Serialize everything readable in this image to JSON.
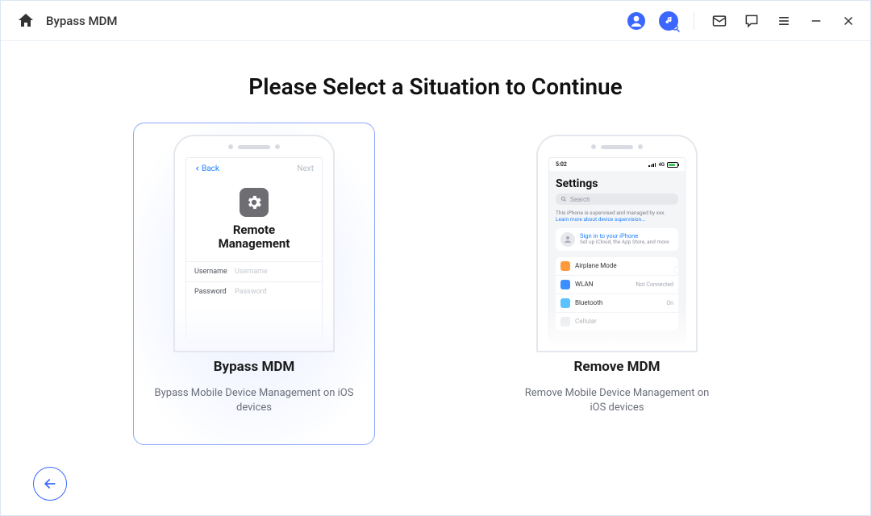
{
  "header": {
    "title": "Bypass MDM"
  },
  "main": {
    "heading": "Please Select a Situation to Continue"
  },
  "options": {
    "bypass": {
      "title": "Bypass MDM",
      "description": "Bypass Mobile Device Management on iOS devices",
      "screen": {
        "back": "Back",
        "next": "Next",
        "title": "Remote\nManagement",
        "field_user_label": "Username",
        "field_user_placeholder": "Username",
        "field_pass_label": "Password",
        "field_pass_placeholder": "Password"
      }
    },
    "remove": {
      "title": "Remove MDM",
      "description": "Remove Mobile Device Management on iOS devices",
      "screen": {
        "time": "5:02",
        "carrier_text": "4G",
        "settings_label": "Settings",
        "search_placeholder": "Search",
        "supervised_note_pre": "This iPhone is supervised and managed by xxx. ",
        "supervised_link": "Learn more about device supervision...",
        "signin_link": "Sign in to your iPhone",
        "signin_sub": "Set up iCloud, the App Store, and more",
        "items": {
          "airplane": "Airplane Mode",
          "wlan": "WLAN",
          "wlan_status": "Not Connected",
          "bt": "Bluetooth",
          "bt_status": "On",
          "cell": "Cellular"
        }
      }
    }
  }
}
